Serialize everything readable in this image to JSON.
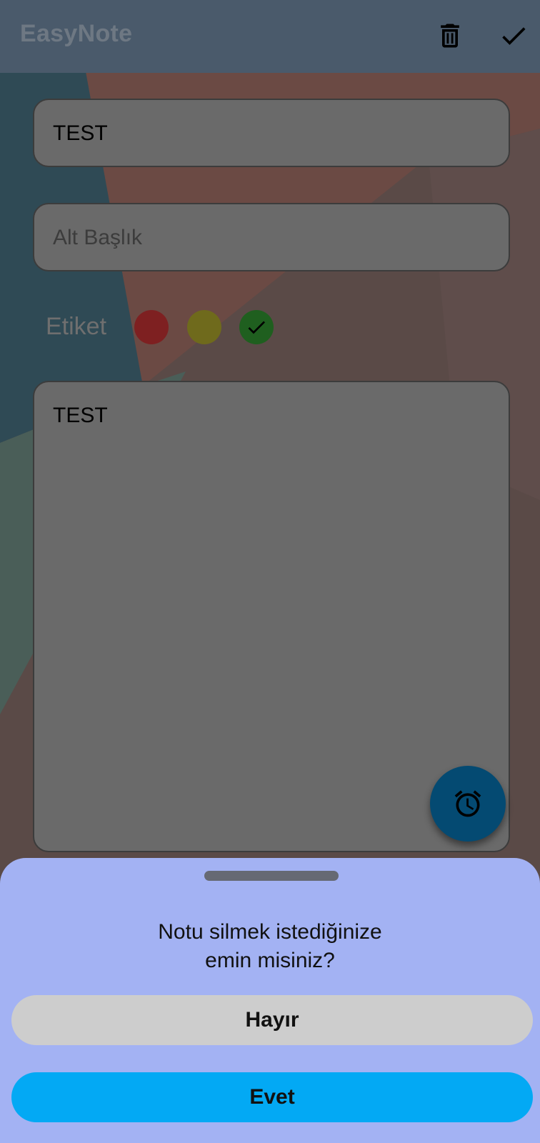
{
  "app_title": "EasyNote",
  "toolbar": {
    "delete_icon": "trash-icon",
    "save_icon": "check-icon"
  },
  "note": {
    "title_value": "TEST",
    "subtitle_placeholder": "Alt Başlık",
    "tag_label": "Etiket",
    "tags": [
      {
        "color": "#7e2021",
        "selected": false
      },
      {
        "color": "#6f6a1c",
        "selected": false
      },
      {
        "color": "#1f5f1f",
        "selected": true
      }
    ],
    "body_value": "TEST"
  },
  "fab": {
    "icon": "alarm-icon"
  },
  "dialog": {
    "question_line1": "Notu silmek istediğinize",
    "question_line2": "emin misiniz?",
    "no_label": "Hayır",
    "yes_label": "Evet"
  },
  "colors": {
    "accent": "#03a9f4",
    "sheet": "#a3b2f3"
  }
}
